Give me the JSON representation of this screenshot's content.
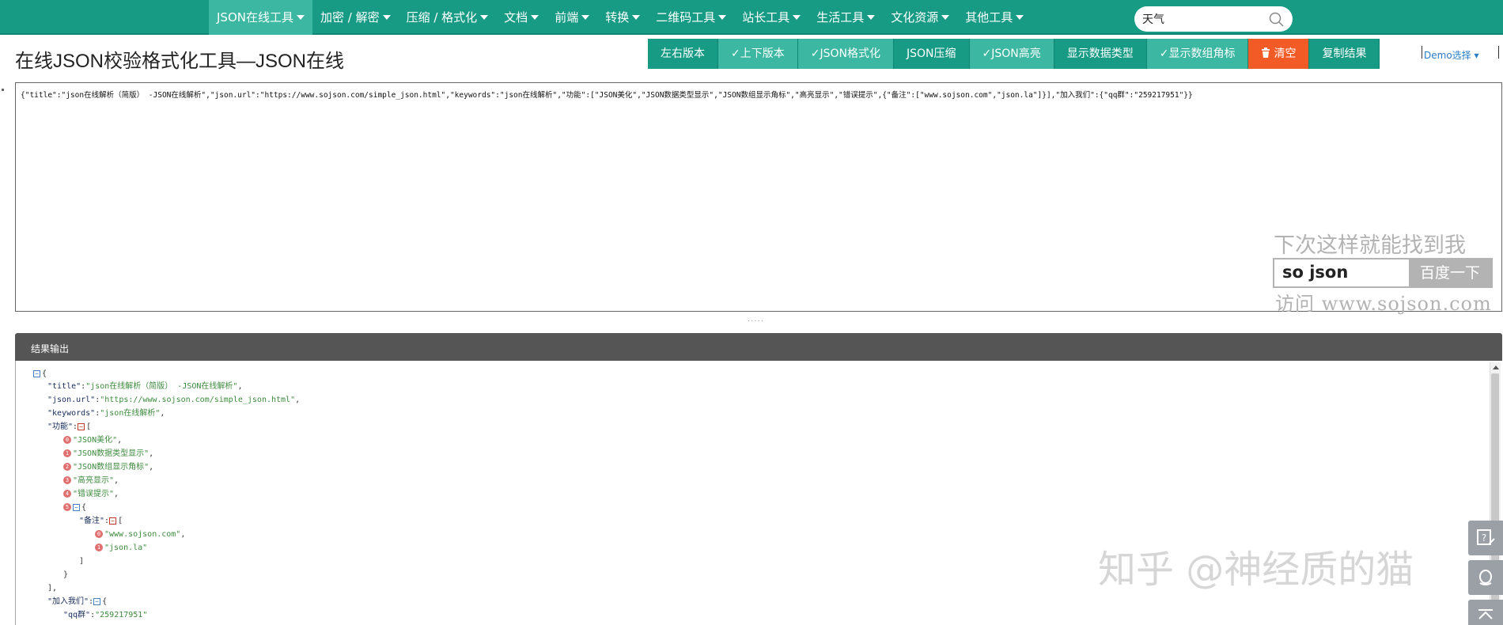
{
  "nav": {
    "items": [
      {
        "label": "JSON在线工具",
        "active": true
      },
      {
        "label": "加密 / 解密",
        "active": false
      },
      {
        "label": "压缩 / 格式化",
        "active": false
      },
      {
        "label": "文档",
        "active": false
      },
      {
        "label": "前端",
        "active": false
      },
      {
        "label": "转换",
        "active": false
      },
      {
        "label": "二维码工具",
        "active": false
      },
      {
        "label": "站长工具",
        "active": false
      },
      {
        "label": "生活工具",
        "active": false
      },
      {
        "label": "文化资源",
        "active": false
      },
      {
        "label": "其他工具",
        "active": false
      }
    ],
    "search_value": "天气"
  },
  "page": {
    "title": "在线JSON校验格式化工具—JSON在线",
    "demo_link": "Demo选择 ▾"
  },
  "toolbar": {
    "buttons": [
      {
        "label": "左右版本",
        "style": "normal"
      },
      {
        "label": "✓上下版本",
        "style": "checked"
      },
      {
        "label": "✓JSON格式化",
        "style": "checked"
      },
      {
        "label": "JSON压缩",
        "style": "normal"
      },
      {
        "label": "✓JSON高亮",
        "style": "checked"
      },
      {
        "label": "显示数据类型",
        "style": "normal"
      },
      {
        "label": "✓显示数组角标",
        "style": "checked"
      },
      {
        "label": "清空",
        "style": "danger"
      },
      {
        "label": "复制结果",
        "style": "normal"
      }
    ]
  },
  "input": {
    "text": "{\"title\":\"json在线解析（简版） -JSON在线解析\",\"json.url\":\"https://www.sojson.com/simple_json.html\",\"keywords\":\"json在线解析\",\"功能\":[\"JSON美化\",\"JSON数据类型显示\",\"JSON数组显示角标\",\"高亮显示\",\"错误提示\",{\"备注\":[\"www.sojson.com\",\"json.la\"]}],\"加入我们\":{\"qq群\":\"259217951\"}}",
    "resize_handle": "....."
  },
  "ad": {
    "slogan": "下次这样就能找到我",
    "query": "so json",
    "button": "百度一下",
    "visit": "访问 www.sojson.com"
  },
  "output": {
    "title": "结果输出",
    "lines": {
      "l0": "{",
      "title_key": "\"title\"",
      "title_val": "\"json在线解析（简版） -JSON在线解析\"",
      "url_key": "\"json.url\"",
      "url_val": "\"https://www.sojson.com/simple_json.html\"",
      "kw_key": "\"keywords\"",
      "kw_val": "\"json在线解析\"",
      "func_key": "\"功能\"",
      "item0": "\"JSON美化\"",
      "item1": "\"JSON数据类型显示\"",
      "item2": "\"JSON数组显示角标\"",
      "item3": "\"高亮显示\"",
      "item4": "\"错误提示\"",
      "note_key": "\"备注\"",
      "note0": "\"www.sojson.com\"",
      "note1": "\"json.la\"",
      "join_key": "\"加入我们\"",
      "qq_key": "\"qq群\"",
      "qq_val": "\"259217951\""
    }
  },
  "watermark": "知乎 @神经质的猫"
}
